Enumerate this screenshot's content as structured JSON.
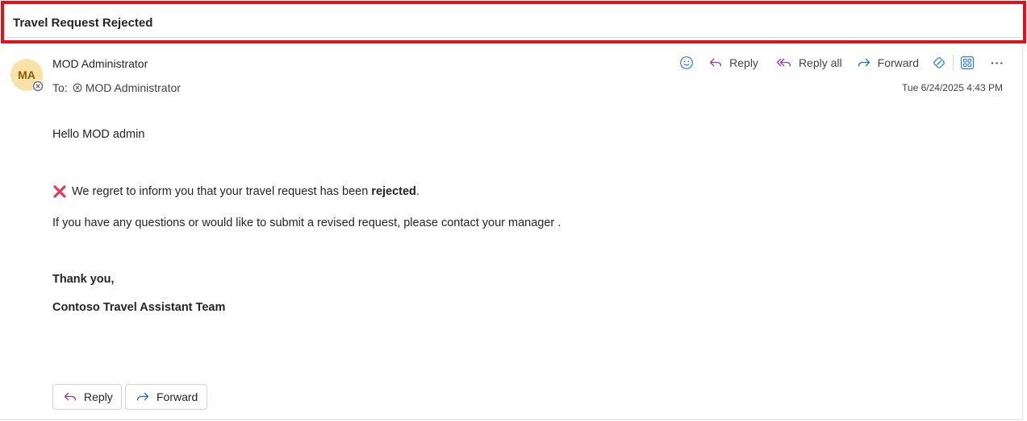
{
  "subject": "Travel Request Rejected",
  "sender": {
    "initials": "MA",
    "name": "MOD Administrator",
    "to_label": "To:",
    "to_name": "MOD Administrator",
    "datetime": "Tue 6/24/2025 4:43 PM"
  },
  "toolbar": {
    "reply": "Reply",
    "reply_all": "Reply all",
    "forward": "Forward",
    "more": "···"
  },
  "body": {
    "greeting": "Hello MOD admin",
    "rejection_prefix": "We regret to inform you that your travel request has been ",
    "rejection_bold": "rejected",
    "rejection_suffix": ".",
    "contact": "If you have any questions or would like to submit a revised request, please contact your manager .",
    "thanks": "Thank you,",
    "team": "Contoso Travel Assistant Team"
  },
  "bottom_buttons": {
    "reply": "Reply",
    "forward": "Forward"
  },
  "colors": {
    "highlight_border": "#e0121c",
    "avatar_bg": "#f8e2a8",
    "avatar_text": "#8a5a06",
    "reply_icon": "#8a3fa8",
    "forward_icon": "#1f6fc0",
    "accent_icon": "#2b7bd6",
    "rejected_icon": "#e23a5c"
  }
}
